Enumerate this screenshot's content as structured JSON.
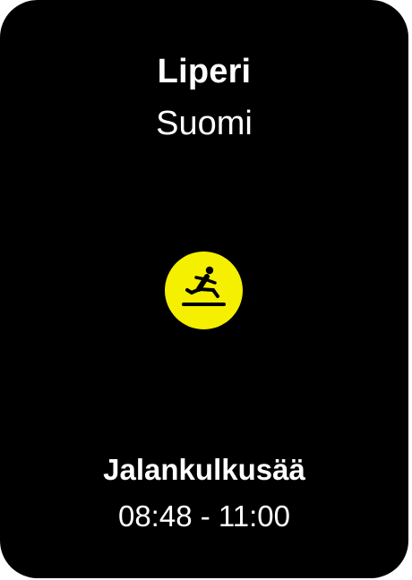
{
  "location": {
    "name": "Liperi",
    "country": "Suomi"
  },
  "warning": {
    "icon": "slippery-pedestrian-icon",
    "title": "Jalankulkusää",
    "time_range": "08:48 - 11:00"
  },
  "colors": {
    "background": "#000000",
    "text": "#ffffff",
    "warning_icon_background": "#f4f000",
    "warning_icon_foreground": "#000000"
  }
}
